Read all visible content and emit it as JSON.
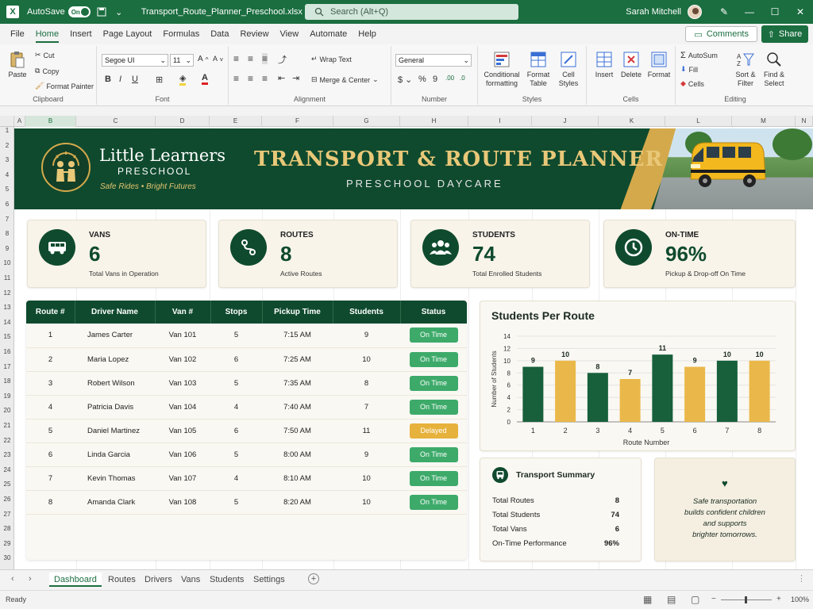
{
  "titlebar": {
    "autosave_label": "AutoSave",
    "autosave_state": "On",
    "filename": "Transport_Route_Planner_Preschool.xlsx",
    "search_placeholder": "Search (Alt+Q)",
    "user_name": "Sarah Mitchell"
  },
  "menu": [
    "File",
    "Home",
    "Insert",
    "Page Layout",
    "Formulas",
    "Data",
    "Review",
    "View",
    "Automate",
    "Help"
  ],
  "menu_active": "Home",
  "comments_label": "Comments",
  "share_label": "Share",
  "ribbon": {
    "paste": "Paste",
    "cut": "Cut",
    "copy": "Copy",
    "format_painter": "Format Painter",
    "clipboard": "Clipboard",
    "font_name": "Segoe UI",
    "font_size": "11",
    "font": "Font",
    "wrap_text": "Wrap Text",
    "merge_center": "Merge & Center",
    "alignment": "Alignment",
    "number_format": "General",
    "number": "Number",
    "conditional_formatting_1": "Conditional",
    "conditional_formatting_2": "formatting",
    "format_table_1": "Format",
    "format_table_2": "Table",
    "cell_styles_1": "Cell",
    "cell_styles_2": "Styles",
    "styles": "Styles",
    "insert": "Insert",
    "delete": "Delete",
    "format": "Format",
    "cells": "Cells",
    "autosum": "AutoSum",
    "fill": "Fill",
    "clear": "Cells",
    "sort_filter_1": "Sort &",
    "sort_filter_2": "Filter",
    "find_select_1": "Find &",
    "find_select_2": "Select",
    "editing": "Editing"
  },
  "columns": [
    "A",
    "B",
    "C",
    "D",
    "E",
    "F",
    "G",
    "H",
    "I",
    "J",
    "K",
    "L",
    "M",
    "N"
  ],
  "banner": {
    "brand_name": "Little Learners",
    "brand_sub": "PRESCHOOL",
    "tagline": "Safe Rides  •  Bright Futures",
    "title": "TRANSPORT & ROUTE PLANNER",
    "subtitle": "PRESCHOOL DAYCARE"
  },
  "kpis": [
    {
      "label": "VANS",
      "value": "6",
      "sub": "Total Vans in Operation",
      "icon": "van-icon"
    },
    {
      "label": "ROUTES",
      "value": "8",
      "sub": "Active Routes",
      "icon": "route-icon"
    },
    {
      "label": "STUDENTS",
      "value": "74",
      "sub": "Total Enrolled Students",
      "icon": "students-icon"
    },
    {
      "label": "ON-TIME",
      "value": "96%",
      "sub": "Pickup & Drop-off On Time",
      "icon": "clock-icon"
    }
  ],
  "table": {
    "headers": [
      "Route #",
      "Driver Name",
      "Van #",
      "Stops",
      "Pickup Time",
      "Students",
      "Status"
    ],
    "rows": [
      [
        "1",
        "James Carter",
        "Van 101",
        "5",
        "7:15 AM",
        "9",
        "On Time"
      ],
      [
        "2",
        "Maria Lopez",
        "Van 102",
        "6",
        "7:25 AM",
        "10",
        "On Time"
      ],
      [
        "3",
        "Robert Wilson",
        "Van 103",
        "5",
        "7:35 AM",
        "8",
        "On Time"
      ],
      [
        "4",
        "Patricia Davis",
        "Van 104",
        "4",
        "7:40 AM",
        "7",
        "On Time"
      ],
      [
        "5",
        "Daniel Martinez",
        "Van 105",
        "6",
        "7:50 AM",
        "11",
        "Delayed"
      ],
      [
        "6",
        "Linda Garcia",
        "Van 106",
        "5",
        "8:00 AM",
        "9",
        "On Time"
      ],
      [
        "7",
        "Kevin Thomas",
        "Van 107",
        "4",
        "8:10 AM",
        "10",
        "On Time"
      ],
      [
        "8",
        "Amanda Clark",
        "Van 108",
        "5",
        "8:20 AM",
        "10",
        "On Time"
      ]
    ]
  },
  "chart_data": {
    "type": "bar",
    "title": "Students Per Route",
    "xlabel": "Route Number",
    "ylabel": "Number of Students",
    "categories": [
      "1",
      "2",
      "3",
      "4",
      "5",
      "6",
      "7",
      "8"
    ],
    "values": [
      9,
      10,
      8,
      7,
      11,
      9,
      10,
      10
    ],
    "bar_colors": [
      "#17603b",
      "#eab84a",
      "#17603b",
      "#eab84a",
      "#17603b",
      "#eab84a",
      "#17603b",
      "#eab84a"
    ],
    "yticks": [
      0,
      2,
      4,
      6,
      8,
      10,
      12,
      14
    ],
    "ylim": [
      0,
      14
    ],
    "grid": true,
    "data_labels": true
  },
  "summary": {
    "title": "Transport Summary",
    "rows": [
      {
        "label": "Total Routes",
        "value": "8"
      },
      {
        "label": "Total Students",
        "value": "74"
      },
      {
        "label": "Total Vans",
        "value": "6"
      },
      {
        "label": "On-Time Performance",
        "value": "96%"
      }
    ]
  },
  "quote": {
    "line1": "Safe transportation",
    "line2": "builds confident children",
    "line3": "and supports",
    "line4": "brighter tomorrows."
  },
  "sheet_tabs": [
    "Dashboard",
    "Routes",
    "Drivers",
    "Vans",
    "Students",
    "Settings"
  ],
  "active_tab": "Dashboard",
  "status": {
    "ready": "Ready",
    "zoom": "100%"
  },
  "colors": {
    "brand": "#1b6e40",
    "dark_green": "#0f4a2e",
    "gold": "#eab84a",
    "on_time": "#3daa6a",
    "delayed": "#e6b23c"
  }
}
